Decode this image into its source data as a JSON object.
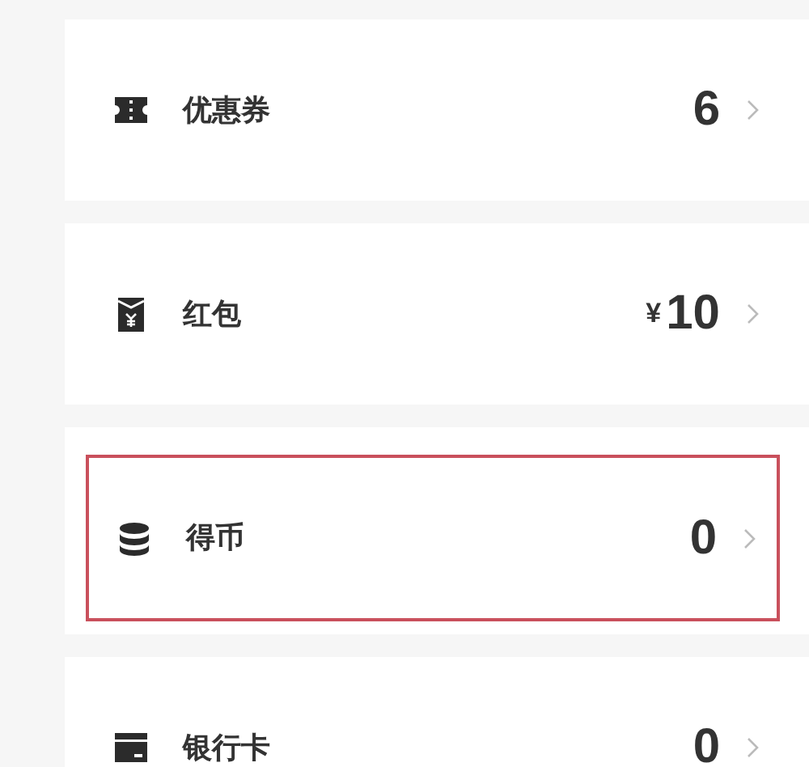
{
  "items": [
    {
      "kind": "ticket",
      "label": "优惠券",
      "value": "6",
      "highlighted": false
    },
    {
      "kind": "envelope",
      "label": "红包",
      "currency": "¥",
      "value": "10",
      "highlighted": false
    },
    {
      "kind": "coins",
      "label": "得币",
      "value": "0",
      "highlighted": true
    },
    {
      "kind": "card",
      "label": "银行卡",
      "value": "0",
      "highlighted": false
    }
  ]
}
